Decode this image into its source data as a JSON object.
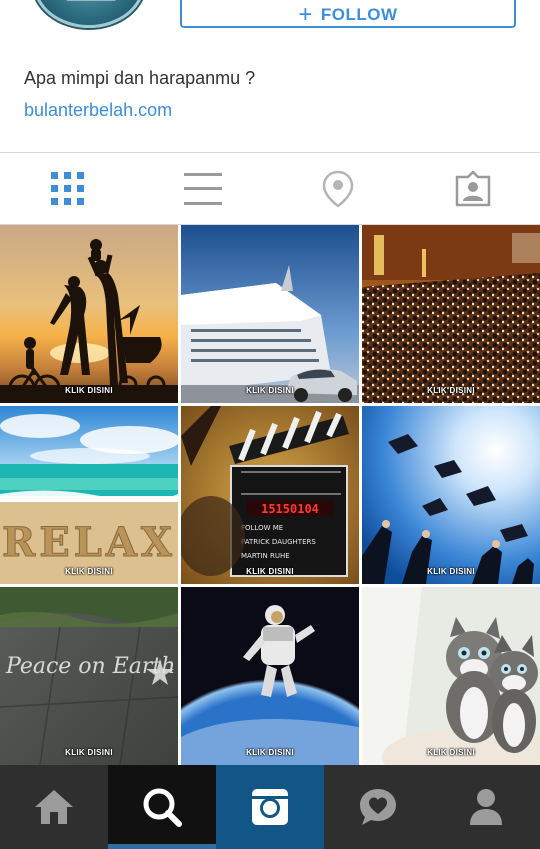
{
  "profile": {
    "follow_label": "FOLLOW",
    "bio": "Apa mimpi dan harapanmu ?",
    "website": "bulanterbelah.com"
  },
  "view_tabs": [
    {
      "name": "grid-view",
      "icon": "grid-icon",
      "active": true
    },
    {
      "name": "list-view",
      "icon": "list-icon",
      "active": false
    },
    {
      "name": "map-view",
      "icon": "location-pin-icon",
      "active": false
    },
    {
      "name": "tagged-view",
      "icon": "tagged-person-icon",
      "active": false
    }
  ],
  "photos": [
    {
      "subject": "family-silhouette-sunset",
      "watermark": "KLIK DISINI"
    },
    {
      "subject": "cruise-ship-car",
      "watermark": "KLIK DISINI"
    },
    {
      "subject": "auditorium-crowd",
      "watermark": "KLIK DISINI"
    },
    {
      "subject": "relax-beach",
      "watermark": "KLIK DISINI"
    },
    {
      "subject": "film-clapperboard",
      "watermark": "KLIK DISINI"
    },
    {
      "subject": "graduation-caps",
      "watermark": "KLIK DISINI"
    },
    {
      "subject": "peace-on-earth-chalk",
      "watermark": "KLIK DISINI"
    },
    {
      "subject": "astronaut-earth",
      "watermark": "KLIK DISINI"
    },
    {
      "subject": "kittens",
      "watermark": "KLIK DISINI"
    }
  ],
  "photo_text": {
    "relax": "RELAX",
    "clapper_number": "15150104",
    "clapper_lines": [
      "FOLLOW ME",
      "PATRICK DAUGHTERS",
      "MARTIN RUHE"
    ],
    "chalk": "Peace on Earth"
  },
  "bottom_nav": [
    {
      "name": "home",
      "icon": "home-icon",
      "active": false
    },
    {
      "name": "explore",
      "icon": "search-icon",
      "active": true
    },
    {
      "name": "camera",
      "icon": "camera-icon",
      "active": false
    },
    {
      "name": "activity",
      "icon": "heart-bubble-icon",
      "active": false
    },
    {
      "name": "profile",
      "icon": "person-icon",
      "active": false
    }
  ],
  "colors": {
    "link_blue": "#3d8ed6",
    "tab_active": "#3d8ed6",
    "tab_inactive": "#9a9a9a",
    "nav_bg": "#2f2f2f",
    "nav_camera_bg": "#125688",
    "nav_active_indicator": "#2e6ea6"
  }
}
